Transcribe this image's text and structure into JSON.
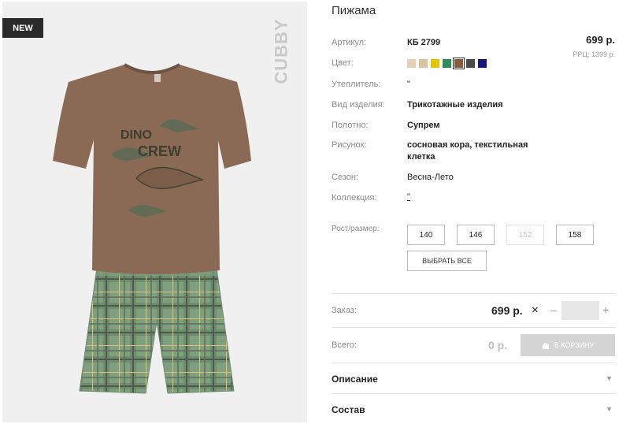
{
  "image": {
    "badge": "NEW",
    "brand": "CUBBY",
    "print_lines": [
      "DINO",
      "CREW"
    ],
    "colors": {
      "background": "#f0f0f0",
      "tshirt": "#8b6a55",
      "shorts_base": "#7f9f7f",
      "plaid_dark": "#4b5a4a",
      "plaid_light": "#d7c37a"
    }
  },
  "product": {
    "title": "Пижама",
    "price": "699 р.",
    "rrp": "РРЦ: 1399 р."
  },
  "attributes": {
    "article": {
      "label": "Артикул:",
      "value": "КБ 2799"
    },
    "color": {
      "label": "Цвет:"
    },
    "insulation": {
      "label": "Утеплитель:",
      "value": "\""
    },
    "type": {
      "label": "Вид изделия:",
      "value": "Трикотажные изделия"
    },
    "fabric": {
      "label": "Полотно:",
      "value": "Супрем"
    },
    "pattern": {
      "label": "Рисунок:",
      "value": "сосновая кора, текстильная клетка"
    },
    "season": {
      "label": "Сезон:",
      "value": "Весна-Лето"
    },
    "collection": {
      "label": "Коллекция:",
      "value": "\""
    }
  },
  "swatches": [
    {
      "color": "#e3d2b6",
      "selected": false
    },
    {
      "color": "#d6c3a0",
      "selected": false
    },
    {
      "color": "#e6c400",
      "selected": false
    },
    {
      "color": "#2e8b57",
      "selected": false
    },
    {
      "color": "#8a5a3c",
      "selected": true
    },
    {
      "color": "#4a4a4a",
      "selected": false
    },
    {
      "color": "#15157a",
      "selected": false
    }
  ],
  "sizes": {
    "label": "Рост/размер:",
    "options": [
      {
        "value": "140",
        "enabled": true
      },
      {
        "value": "146",
        "enabled": true
      },
      {
        "value": "152",
        "enabled": false
      },
      {
        "value": "158",
        "enabled": true
      }
    ],
    "select_all": "ВЫБРАТЬ ВСЕ"
  },
  "order": {
    "label": "Заказ:",
    "price": "699 р.",
    "times": "×",
    "minus": "–",
    "plus": "+",
    "quantity": ""
  },
  "total": {
    "label": "Всего:",
    "value": "0 р.",
    "cart_button": "В КОРЗИНУ"
  },
  "accordion": [
    {
      "title": "Описание"
    },
    {
      "title": "Состав"
    }
  ]
}
